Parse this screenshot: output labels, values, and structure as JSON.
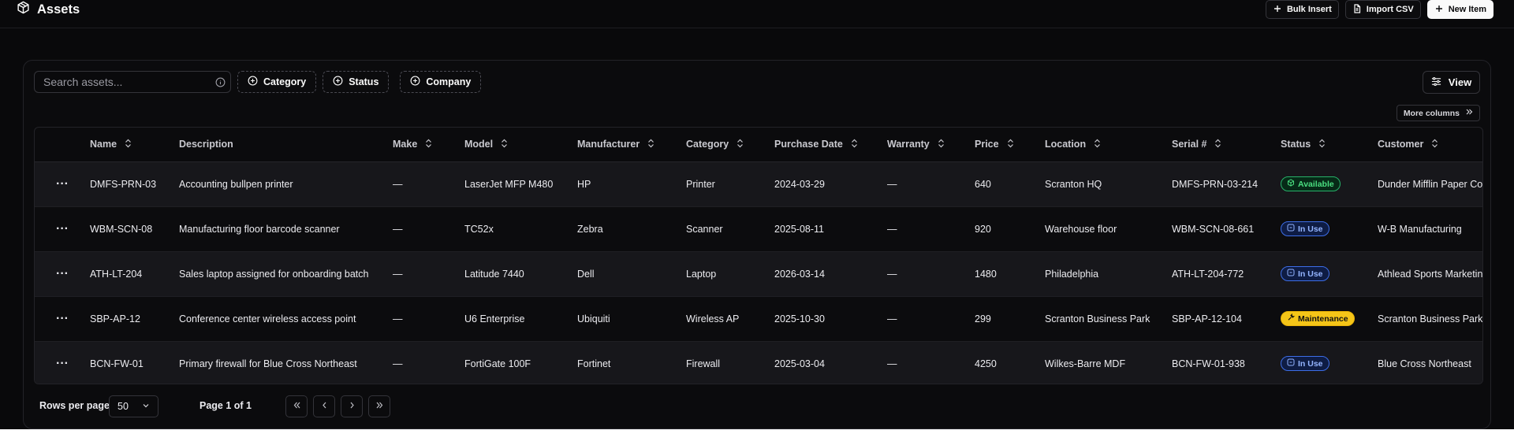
{
  "header": {
    "title": "Assets",
    "icon": "package-icon",
    "actions": [
      {
        "label": "Bulk Insert",
        "icon": "plus-icon"
      },
      {
        "label": "Import CSV",
        "icon": "file-icon"
      },
      {
        "label": "New Item",
        "icon": "plus-icon"
      }
    ]
  },
  "toolbar": {
    "search_placeholder": "Search assets...",
    "filters": [
      "Category",
      "Status",
      "Company"
    ],
    "view_label": "View",
    "more_columns_label": "More columns"
  },
  "table": {
    "columns": [
      "",
      "Name",
      "Description",
      "Make",
      "Model",
      "Manufacturer",
      "Category",
      "Purchase Date",
      "Warranty",
      "Price",
      "Location",
      "Serial #",
      "Status",
      "Customer"
    ],
    "rows": [
      {
        "actions": "···",
        "name": "DMFS-PRN-03",
        "description": "Accounting bullpen printer",
        "make": "—",
        "model": "LaserJet MFP M480",
        "manufacturer": "HP",
        "category": "Printer",
        "purchase_date": "2024-03-29",
        "warranty": "—",
        "price": "640",
        "location": "Scranton HQ",
        "serial": "DMFS-PRN-03-214",
        "status": "Available",
        "customer": "Dunder Mifflin Paper Co"
      },
      {
        "actions": "···",
        "name": "WBM-SCN-08",
        "description": "Manufacturing floor barcode scanner",
        "make": "—",
        "model": "TC52x",
        "manufacturer": "Zebra",
        "category": "Scanner",
        "purchase_date": "2025-08-11",
        "warranty": "—",
        "price": "920",
        "location": "Warehouse floor",
        "serial": "WBM-SCN-08-661",
        "status": "In Use",
        "customer": "W-B Manufacturing"
      },
      {
        "actions": "···",
        "name": "ATH-LT-204",
        "description": "Sales laptop assigned for onboarding batch",
        "make": "—",
        "model": "Latitude 7440",
        "manufacturer": "Dell",
        "category": "Laptop",
        "purchase_date": "2026-03-14",
        "warranty": "—",
        "price": "1480",
        "location": "Philadelphia",
        "serial": "ATH-LT-204-772",
        "status": "In Use",
        "customer": "Athlead Sports Marketing"
      },
      {
        "actions": "···",
        "name": "SBP-AP-12",
        "description": "Conference center wireless access point",
        "make": "—",
        "model": "U6 Enterprise",
        "manufacturer": "Ubiquiti",
        "category": "Wireless AP",
        "purchase_date": "2025-10-30",
        "warranty": "—",
        "price": "299",
        "location": "Scranton Business Park",
        "serial": "SBP-AP-12-104",
        "status": "Maintenance",
        "customer": "Scranton Business Park"
      },
      {
        "actions": "···",
        "name": "BCN-FW-01",
        "description": "Primary firewall for Blue Cross Northeast",
        "make": "—",
        "model": "FortiGate 100F",
        "manufacturer": "Fortinet",
        "category": "Firewall",
        "purchase_date": "2025-03-04",
        "warranty": "—",
        "price": "4250",
        "location": "Wilkes-Barre MDF",
        "serial": "BCN-FW-01-938",
        "status": "In Use",
        "customer": "Blue Cross Northeast"
      }
    ]
  },
  "pagination": {
    "rows_per_page_label": "Rows per page",
    "rows_per_page_value": "50",
    "page_info": "Page 1 of 1"
  },
  "colors": {
    "background": "#09090b",
    "available": "#4ade80",
    "in_use": "#93b4ff",
    "maintenance": "#f5c518"
  }
}
